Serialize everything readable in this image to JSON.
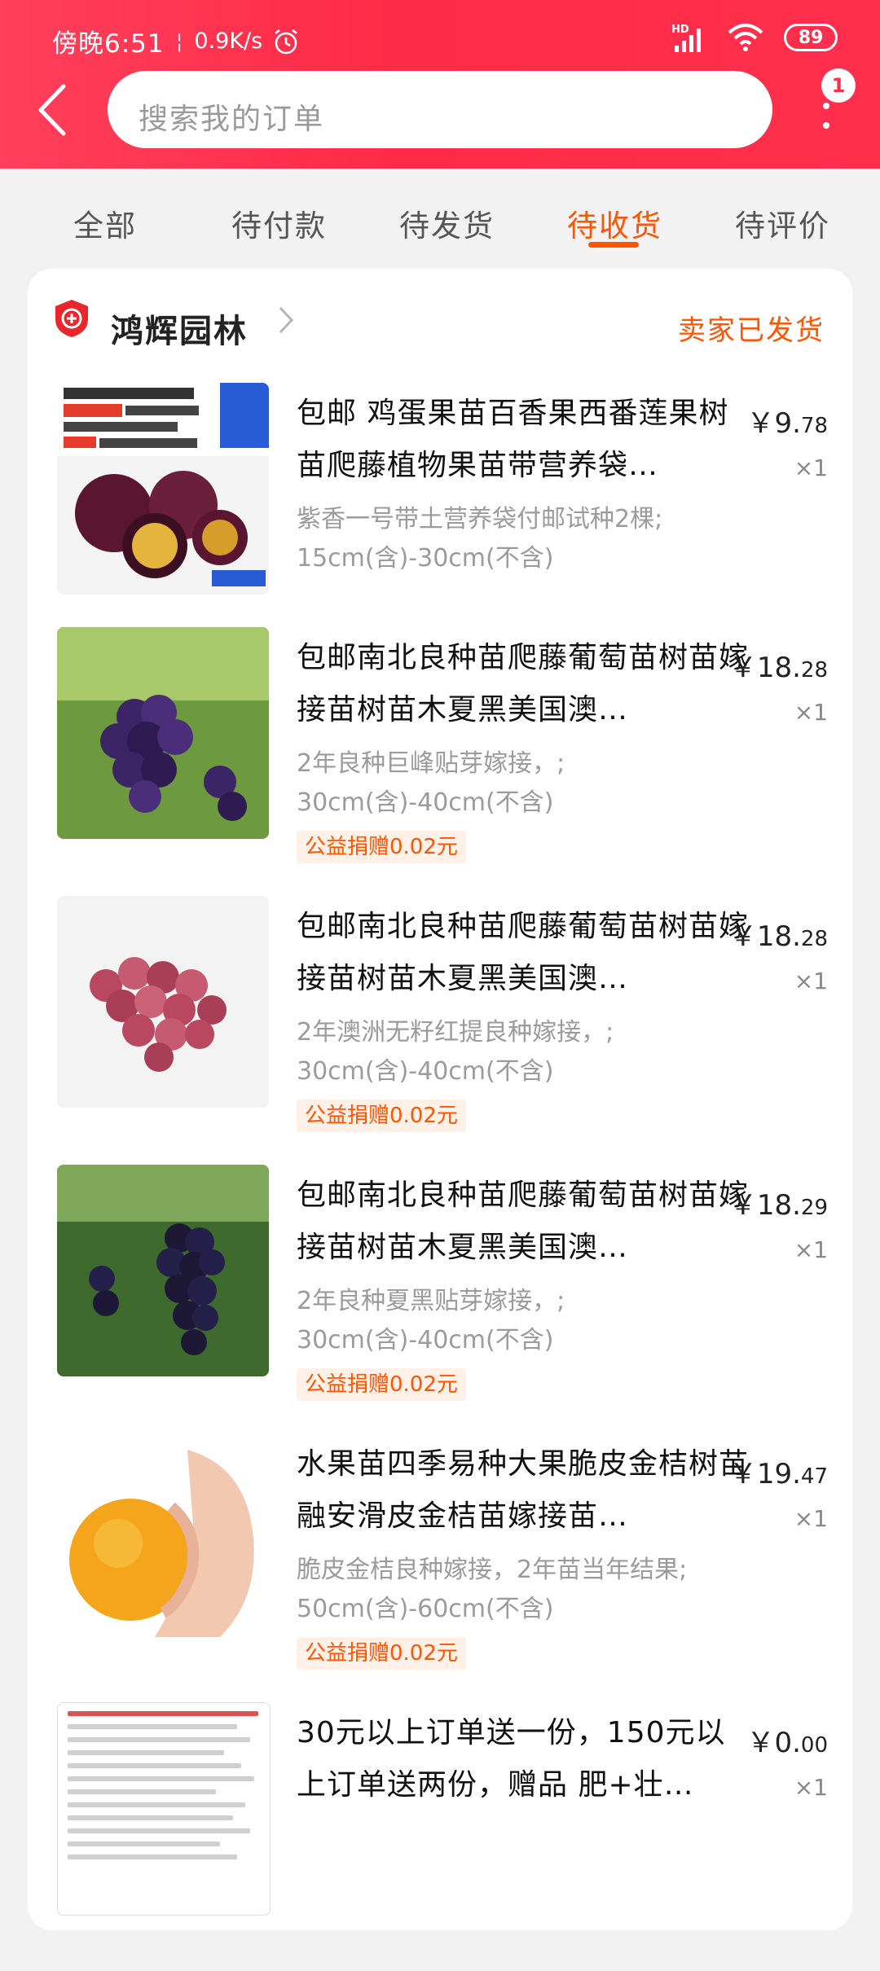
{
  "status_bar": {
    "time": "傍晚6:51",
    "separator": "¦",
    "net_speed": "0.9K/s",
    "hd_label": "HD",
    "battery": "89"
  },
  "header": {
    "search_placeholder": "搜索我的订单",
    "badge_count": "1"
  },
  "tabs": [
    {
      "label": "全部",
      "active": false
    },
    {
      "label": "待付款",
      "active": false
    },
    {
      "label": "待发货",
      "active": false
    },
    {
      "label": "待收货",
      "active": true
    },
    {
      "label": "待评价",
      "active": false
    }
  ],
  "shop": {
    "name": "鸿辉园林",
    "status": "卖家已发货"
  },
  "items": [
    {
      "title": "包邮 鸡蛋果苗百香果西番莲果树苗爬藤植物果苗带营养袋…",
      "sku_line1": "紫香一号带土营养袋付邮试种2棵;",
      "sku_line2": "15cm(含)-30cm(不含)",
      "price_main": "￥9.",
      "price_decimal": "78",
      "qty": "×1",
      "charity": "",
      "image": "passionfruit"
    },
    {
      "title": "包邮南北良种苗爬藤葡萄苗树苗嫁接苗树苗木夏黑美国澳…",
      "sku_line1": "2年良种巨峰贴芽嫁接，;",
      "sku_line2": "30cm(含)-40cm(不含)",
      "price_main": "￥18.",
      "price_decimal": "28",
      "qty": "×1",
      "charity": "公益捐赠0.02元",
      "image": "grape-purple"
    },
    {
      "title": "包邮南北良种苗爬藤葡萄苗树苗嫁接苗树苗木夏黑美国澳…",
      "sku_line1": "2年澳洲无籽红提良种嫁接，;",
      "sku_line2": "30cm(含)-40cm(不含)",
      "price_main": "￥18.",
      "price_decimal": "28",
      "qty": "×1",
      "charity": "公益捐赠0.02元",
      "image": "grape-red"
    },
    {
      "title": "包邮南北良种苗爬藤葡萄苗树苗嫁接苗树苗木夏黑美国澳…",
      "sku_line1": "2年良种夏黑贴芽嫁接，;",
      "sku_line2": "30cm(含)-40cm(不含)",
      "price_main": "￥18.",
      "price_decimal": "29",
      "qty": "×1",
      "charity": "公益捐赠0.02元",
      "image": "grape-black"
    },
    {
      "title": "水果苗四季易种大果脆皮金桔树苗融安滑皮金桔苗嫁接苗…",
      "sku_line1": "脆皮金桔良种嫁接，2年苗当年结果;",
      "sku_line2": "50cm(含)-60cm(不含)",
      "price_main": "￥19.",
      "price_decimal": "47",
      "qty": "×1",
      "charity": "公益捐赠0.02元",
      "image": "kumquat"
    },
    {
      "title": "30元以上订单送一份，150元以上订单送两份，赠品 肥+壮…",
      "sku_line1": "",
      "sku_line2": "",
      "price_main": "￥0.",
      "price_decimal": "00",
      "qty": "×1",
      "charity": "",
      "image": "gift-list"
    }
  ],
  "colors": {
    "header_red": "#ff2d4a",
    "accent_orange": "#ff5500"
  }
}
